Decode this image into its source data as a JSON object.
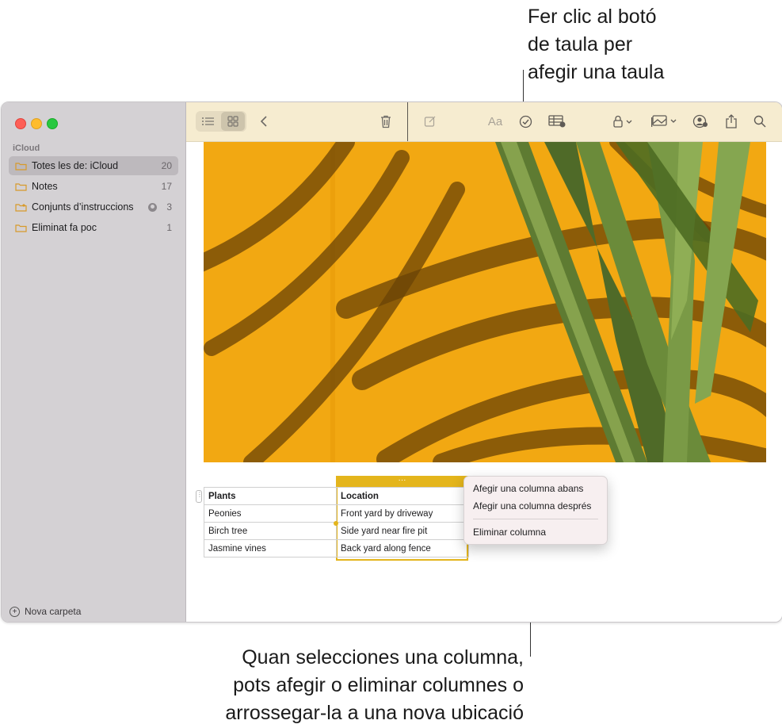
{
  "callouts": {
    "top": [
      "Fer clic al botó",
      "de taula per",
      "afegir una taula"
    ],
    "bottom": [
      "Quan selecciones una columna,",
      "pots afegir o eliminar columnes o",
      "arrossegar-la a una nova ubicació"
    ]
  },
  "sidebar": {
    "section_label": "iCloud",
    "items": [
      {
        "label": "Totes les de: iCloud",
        "count": "20",
        "selected": true
      },
      {
        "label": "Notes",
        "count": "17"
      },
      {
        "label": "Conjunts d’instruccions",
        "count": "3",
        "shared": true
      },
      {
        "label": "Eliminat fa poc",
        "count": "1"
      }
    ],
    "new_folder_label": "Nova carpeta"
  },
  "toolbar": {
    "icons": [
      "list-view-icon",
      "gallery-view-icon",
      "back-icon",
      "trash-icon",
      "compose-icon",
      "format-icon",
      "checklist-icon",
      "table-icon",
      "lock-icon",
      "media-icon",
      "collaborate-icon",
      "share-icon",
      "search-icon"
    ],
    "format_label": "Aa"
  },
  "table": {
    "headers": [
      "Plants",
      "Location"
    ],
    "rows": [
      [
        "Peonies",
        "Front yard by driveway"
      ],
      [
        "Birch tree",
        "Side yard near fire pit"
      ],
      [
        "Jasmine vines",
        "Back yard along fence"
      ]
    ],
    "column_handle": "···"
  },
  "context_menu": {
    "items": [
      "Afegir una columna abans",
      "Afegir una columna després",
      "Eliminar columna"
    ]
  },
  "colors": {
    "selection": "#e4b51c",
    "toolbar_bg": "#f6ecd0",
    "sidebar_bg": "#d4d1d4"
  }
}
